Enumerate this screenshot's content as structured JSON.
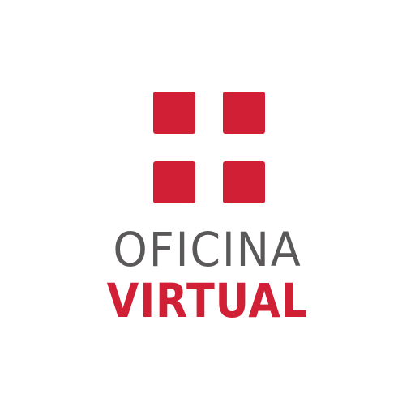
{
  "logo": {
    "line1": "OFICINA",
    "line2": "VIRTUAL",
    "colors": {
      "mark": "#d11f35",
      "line1": "#5b585a",
      "line2": "#d11f35",
      "background": "#ffffff"
    }
  }
}
